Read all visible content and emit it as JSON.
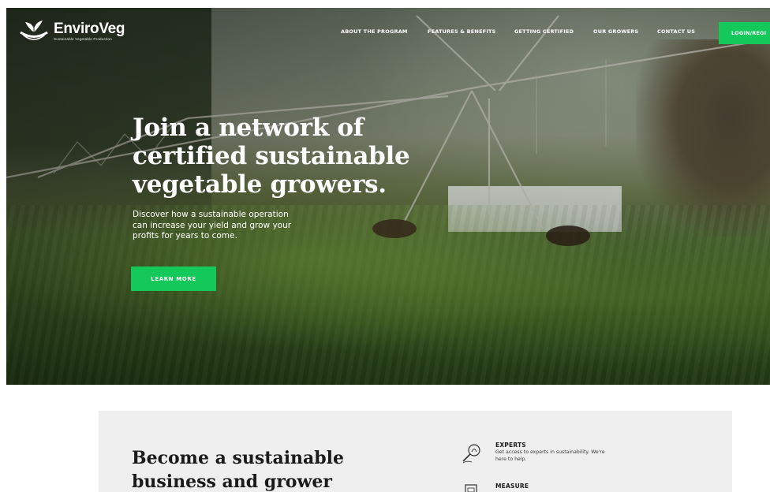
{
  "header": {
    "brand": "EnviroVeg",
    "tagline": "Sustainable Vegetable Production",
    "nav": [
      {
        "label": "ABOUT THE PROGRAM"
      },
      {
        "label": "FEATURES & BENEFITS"
      },
      {
        "label": "GETTING CERTIFIED"
      },
      {
        "label": "OUR GROWERS"
      },
      {
        "label": "CONTACT US"
      }
    ],
    "login_label": "LOGIN/REGI"
  },
  "hero": {
    "headline_line1": "Join a network of",
    "headline_line2": "certified sustainable",
    "headline_line3": "vegetable growers.",
    "sub_line1": "Discover how a sustainable operation",
    "sub_line2": "can increase your yield and grow your",
    "sub_line3": "profits for years to come.",
    "cta_label": "LEARN MORE"
  },
  "benefits": {
    "title_line1": "Become a sustainable",
    "title_line2": "business and grower",
    "features": [
      {
        "title": "EXPERTS",
        "desc_line1": "Get access to experts in sustainability. We're",
        "desc_line2": "here to help.",
        "icon": "expert-magnifier-icon"
      },
      {
        "title": "MEASURE",
        "desc_line1": "",
        "desc_line2": "",
        "icon": "measure-clipboard-icon"
      }
    ]
  },
  "colors": {
    "accent": "#14c85a",
    "panel_bg": "#efefef",
    "heading": "#1b1b1b"
  }
}
